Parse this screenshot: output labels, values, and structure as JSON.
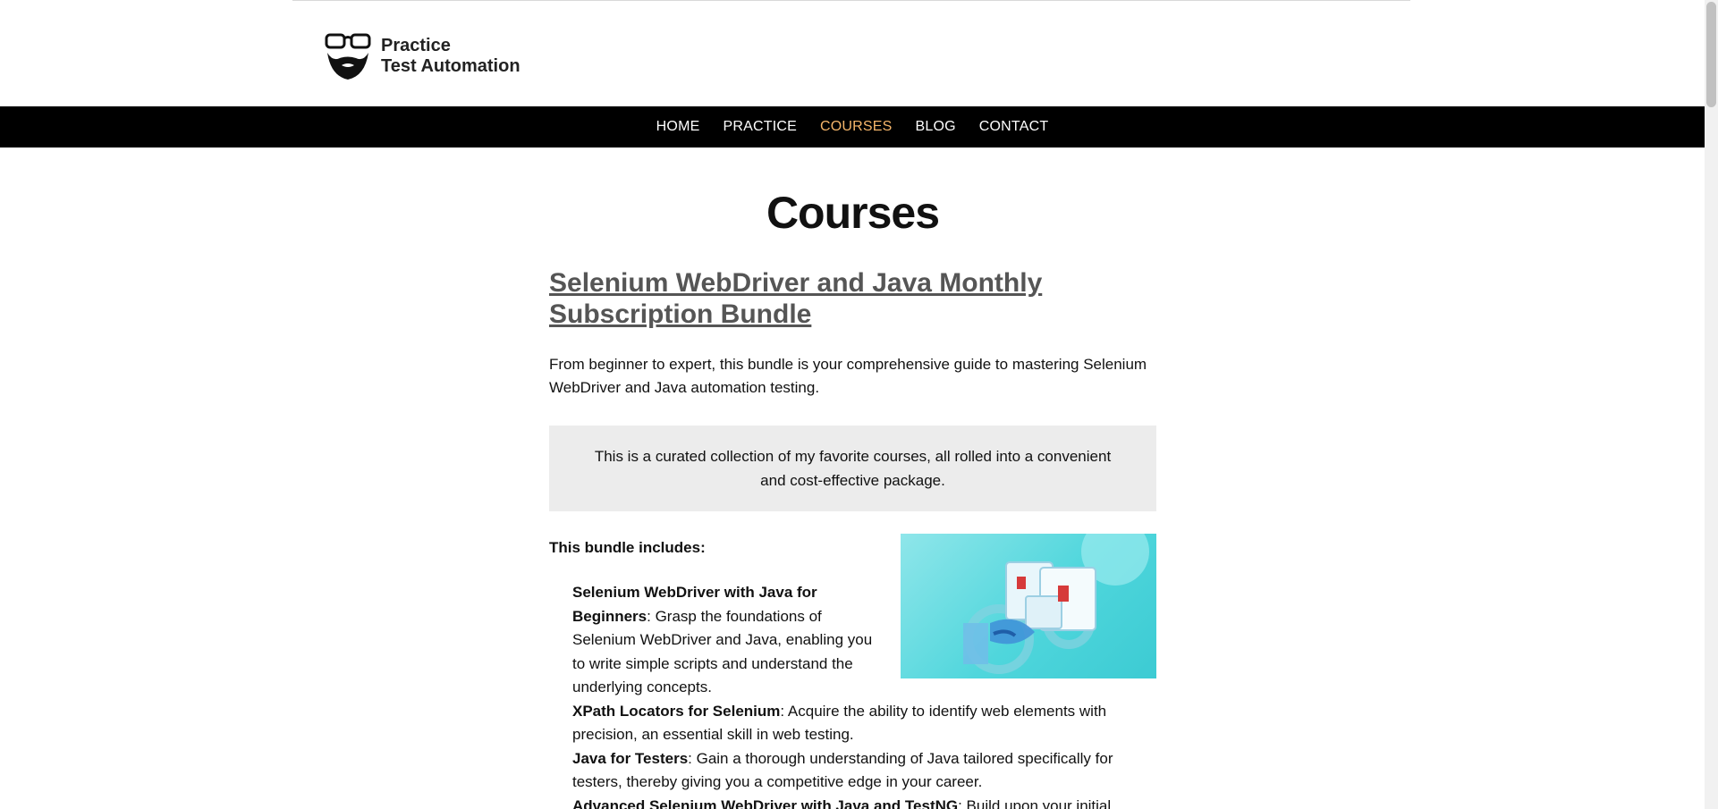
{
  "header": {
    "logo_line1": "Practice",
    "logo_line2": "Test Automation"
  },
  "nav": {
    "items": [
      {
        "label": "HOME",
        "active": false
      },
      {
        "label": "PRACTICE",
        "active": false
      },
      {
        "label": "COURSES",
        "active": true
      },
      {
        "label": "BLOG",
        "active": false
      },
      {
        "label": "CONTACT",
        "active": false
      }
    ]
  },
  "main": {
    "page_title": "Courses",
    "bundle_title": "Selenium WebDriver and Java Monthly Subscription Bundle",
    "intro": "From beginner to expert, this bundle is your comprehensive guide to mastering Selenium WebDriver and Java automation testing.",
    "callout": "This is a curated collection of my favorite courses, all rolled into a convenient and cost-effective package.",
    "includes_label": "This bundle includes:",
    "courses": [
      {
        "name": "Selenium WebDriver with Java for Beginners",
        "desc": ": Grasp the foundations of Selenium WebDriver and Java, enabling you to write simple scripts and understand the underlying concepts."
      },
      {
        "name": "XPath Locators for Selenium",
        "desc": ": Acquire the ability to identify web elements with precision, an essential skill in web testing."
      },
      {
        "name": "Java for Testers",
        "desc": ": Gain a thorough understanding of Java tailored specifically for testers, thereby giving you a competitive edge in your career."
      },
      {
        "name": "Advanced Selenium WebDriver with Java and TestNG",
        "desc": ": Build upon your initial"
      }
    ]
  },
  "colors": {
    "nav_bg": "#000000",
    "nav_active": "#f6b66a",
    "callout_bg": "#ececec",
    "link_gray": "#555555"
  }
}
